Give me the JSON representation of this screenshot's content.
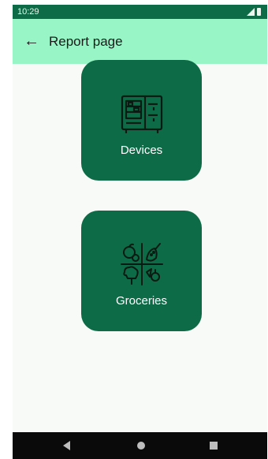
{
  "status_bar": {
    "time": "10:29",
    "signal_icon": "signal-icon",
    "battery_icon": "battery-icon"
  },
  "app_bar": {
    "back_icon": "arrow-left-icon",
    "back_glyph": "←",
    "title": "Report page",
    "background": "#97f5c6"
  },
  "cards": [
    {
      "label": "Devices",
      "icon": "fridge-icon"
    },
    {
      "label": "Groceries",
      "icon": "groceries-icon"
    }
  ],
  "colors": {
    "card": "#0e6b47",
    "status_bar": "#0e6b47",
    "nav_bar": "#0a0a0a"
  },
  "nav_bar": {
    "back_icon": "nav-back-icon",
    "home_icon": "nav-home-icon",
    "recents_icon": "nav-recents-icon"
  }
}
